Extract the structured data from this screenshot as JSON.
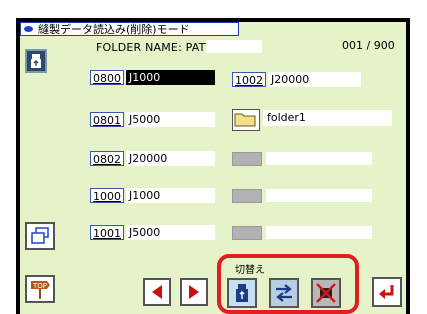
{
  "window": {
    "title": "縫製データ読込み(削除)モード"
  },
  "header": {
    "folder_label": "FOLDER NAME: PATTERN",
    "counter": "001 / 900"
  },
  "left_entries": [
    {
      "number": "0800",
      "name": "J1000",
      "selected": true
    },
    {
      "number": "0801",
      "name": "J5000",
      "selected": false
    },
    {
      "number": "0802",
      "name": "J20000",
      "selected": false
    },
    {
      "number": "1000",
      "name": "J1000",
      "selected": false
    },
    {
      "number": "1001",
      "name": "J5000",
      "selected": false
    }
  ],
  "right_entries": [
    {
      "number": "1002",
      "name": "J20000"
    }
  ],
  "folder_entry": {
    "name": "folder1",
    "icon": "folder-icon"
  },
  "empty_slots": 3,
  "side_buttons": {
    "usb_icon": "usb-drive-icon",
    "window_icon": "window-stack-icon",
    "top_icon": "top-signpost-icon"
  },
  "nav": {
    "prev_icon": "left-arrow-icon",
    "next_icon": "right-arrow-icon"
  },
  "switch_panel": {
    "label": "切替え",
    "buttons": [
      {
        "icon": "usb-drive-icon",
        "state": "active"
      },
      {
        "icon": "swap-arrows-icon",
        "state": "normal"
      },
      {
        "icon": "machine-crossed-icon",
        "state": "disabled"
      }
    ]
  },
  "enter_icon": "enter-return-icon",
  "colors": {
    "screen_bg": "#e6f2c8",
    "accent_blue": "#1e40c8",
    "highlight_red": "#e02020"
  }
}
